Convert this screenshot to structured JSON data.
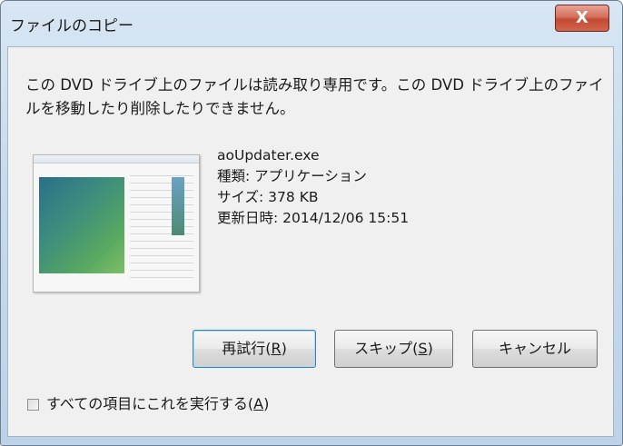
{
  "window": {
    "title": "ファイルのコピー",
    "close_glyph": "X"
  },
  "message": "この DVD ドライブ上のファイルは読み取り専用です。この DVD ドライブ上のファイルを移動したり削除したりできません。",
  "file": {
    "name": "aoUpdater.exe",
    "type": "種類: アプリケーション",
    "size": "サイズ: 378 KB",
    "modified": "更新日時: 2014/12/06 15:51"
  },
  "buttons": {
    "retry_text": "再試行(",
    "retry_key": "R",
    "retry_end": ")",
    "skip_text": "スキップ(",
    "skip_key": "S",
    "skip_end": ")",
    "cancel": "キャンセル"
  },
  "checkbox": {
    "text": "すべての項目にこれを実行する(",
    "key": "A",
    "end": ")",
    "checked": false
  },
  "colors": {
    "close_button": "#c24a32",
    "default_button_border": "#3c7fb1"
  }
}
